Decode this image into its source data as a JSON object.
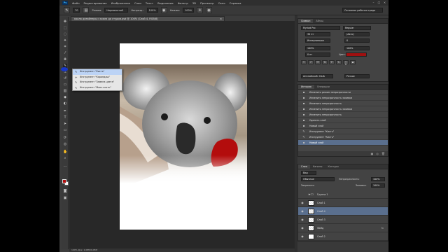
{
  "app": {
    "logo": "Ps",
    "window_controls": [
      "–",
      "□",
      "×"
    ]
  },
  "menu": [
    "Файл",
    "Редактирование",
    "Изображение",
    "Слои",
    "Текст",
    "Выделение",
    "Фильтр",
    "3D",
    "Просмотр",
    "Окно",
    "Справка"
  ],
  "options": {
    "tool_icon": "brush-icon",
    "brush_size": "70",
    "mode_label": "Режим:",
    "mode_value": "Нормальный",
    "opacity_label": "Непрозр.:",
    "opacity_value": "100%",
    "flow_label": "Нажим:",
    "flow_value": "100%",
    "workspace": "Основная рабочая среда"
  },
  "document": {
    "tab_title": "коала дизайнеры с коала до студии.psd @ 100% (Слой 4, RGB/8)",
    "close": "×",
    "status": "100%   Док: 1,08M/4,05M"
  },
  "tool_popup": {
    "items": [
      {
        "label": "Инструмент \"Кисть\"",
        "shortcut": "B",
        "selected": true
      },
      {
        "label": "Инструмент \"Карандаш\"",
        "shortcut": "B",
        "selected": false
      },
      {
        "label": "Инструмент \"Замена цвета\"",
        "shortcut": "B",
        "selected": false
      },
      {
        "label": "Инструмент \"Микс-кисть\"",
        "shortcut": "B",
        "selected": false
      }
    ]
  },
  "character_panel": {
    "tabs": [
      "Символ",
      "Абзац"
    ],
    "font_family": "Myriad Pro",
    "font_style": "Regular",
    "font_size": "30 пт",
    "leading": "(Авто)",
    "tracking_label": "Интерлиньяж",
    "tracking_value": "0",
    "vertical_scale": "100%",
    "horizontal_scale": "100%",
    "baseline": "0 пт",
    "color_label": "Цвет:",
    "color_hex": "#a01010",
    "language": "Английский: США",
    "antialias": "Резкое",
    "style_buttons": [
      "T",
      "T",
      "TT",
      "Tt",
      "T¹",
      "T₁",
      "T",
      "T"
    ]
  },
  "history_panel": {
    "tabs": [
      "История",
      "Операции"
    ],
    "items": [
      {
        "icon": "history-step-icon",
        "label": "Изменить режим непрозрачности",
        "selected": false
      },
      {
        "icon": "history-step-icon",
        "label": "Изменить непрозрачность заливки",
        "selected": false
      },
      {
        "icon": "history-step-icon",
        "label": "Изменить непрозрачность",
        "selected": false
      },
      {
        "icon": "history-step-icon",
        "label": "Изменить непрозрачность заливки",
        "selected": false
      },
      {
        "icon": "history-step-icon",
        "label": "Изменить непрозрачность",
        "selected": false
      },
      {
        "icon": "history-step-icon",
        "label": "Удалить слой",
        "selected": false
      },
      {
        "icon": "history-step-icon",
        "label": "Новый слой",
        "selected": false
      },
      {
        "icon": "history-brush-icon",
        "label": "Инструмент \"Кисть\"",
        "selected": false
      },
      {
        "icon": "history-brush-icon",
        "label": "Инструмент \"Кисть\"",
        "selected": false
      },
      {
        "icon": "history-step-icon",
        "label": "Новый слой",
        "selected": true
      }
    ]
  },
  "layers_panel": {
    "tabs": [
      "Слои",
      "Каналы",
      "Контуры"
    ],
    "filter_label": "Вид",
    "blend_mode": "Обычные",
    "opacity_label": "Непрозрачность:",
    "opacity_value": "100%",
    "lock_label": "Закрепить:",
    "fill_label": "Заливка:",
    "fill_value": "100%",
    "layers": [
      {
        "name": "Группа 1",
        "kind": "folder",
        "selected": false,
        "fx": ""
      },
      {
        "name": "Слой 1",
        "kind": "checker",
        "selected": false,
        "fx": ""
      },
      {
        "name": "Слой 4",
        "kind": "checker",
        "selected": true,
        "fx": ""
      },
      {
        "name": "Слой 3",
        "kind": "checker",
        "selected": false,
        "fx": ""
      },
      {
        "name": "Фейд",
        "kind": "checker",
        "selected": false,
        "fx": "fx"
      },
      {
        "name": "Слой 2",
        "kind": "white",
        "selected": false,
        "fx": ""
      }
    ]
  }
}
